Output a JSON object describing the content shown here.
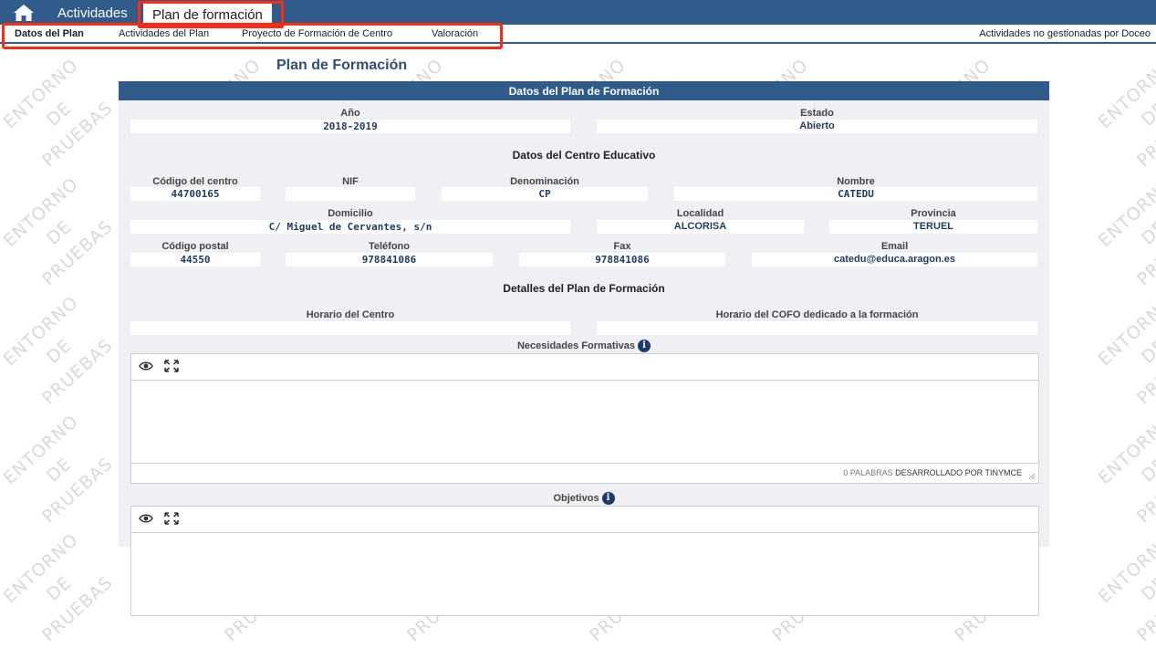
{
  "watermark": {
    "line1": "ENTORNO",
    "line2": "DE",
    "line3": "PRUEBAS"
  },
  "topbar": {
    "home_icon": "home-icon",
    "tabs": [
      {
        "label": "Actividades"
      },
      {
        "label": "Plan de formación"
      }
    ]
  },
  "subnav": {
    "items": [
      {
        "label": "Datos del Plan"
      },
      {
        "label": "Actividades del Plan"
      },
      {
        "label": "Proyecto de Formación de Centro"
      },
      {
        "label": "Valoración"
      }
    ],
    "right_link": "Actividades no gestionadas por Doceo"
  },
  "page": {
    "title": "Plan de Formación"
  },
  "panel": {
    "header": "Datos del Plan de Formación",
    "anio": {
      "label": "Año",
      "value": "2018-2019"
    },
    "estado": {
      "label": "Estado",
      "value": "Abierto"
    },
    "centro_title": "Datos del Centro Educativo",
    "codigo_centro": {
      "label": "Código del centro",
      "value": "44700165"
    },
    "nif": {
      "label": "NIF",
      "value": ""
    },
    "denominacion": {
      "label": "Denominación",
      "value": "CP"
    },
    "nombre": {
      "label": "Nombre",
      "value": "CATEDU"
    },
    "domicilio": {
      "label": "Domicilio",
      "value": "C/ Miguel de Cervantes, s/n"
    },
    "localidad": {
      "label": "Localidad",
      "value": "ALCORISA"
    },
    "provincia": {
      "label": "Provincia",
      "value": "TERUEL"
    },
    "codigo_postal": {
      "label": "Código postal",
      "value": "44550"
    },
    "telefono": {
      "label": "Teléfono",
      "value": "978841086"
    },
    "fax": {
      "label": "Fax",
      "value": "978841086"
    },
    "email": {
      "label": "Email",
      "value": "catedu@educa.aragon.es"
    },
    "detalles_title": "Detalles del Plan de Formación",
    "horario_centro": {
      "label": "Horario del Centro",
      "value": ""
    },
    "horario_cofo": {
      "label": "Horario del COFO dedicado a la formación",
      "value": ""
    },
    "necesidades": {
      "label": "Necesidades Formativas",
      "word_count": "0 PALABRAS",
      "powered": "DESARROLLADO POR TINYMCE"
    },
    "objetivos": {
      "label": "Objetivos"
    }
  },
  "colors": {
    "brand": "#2f5c8a",
    "highlight": "#ff2a12",
    "panel_bg": "#eef0f4"
  }
}
